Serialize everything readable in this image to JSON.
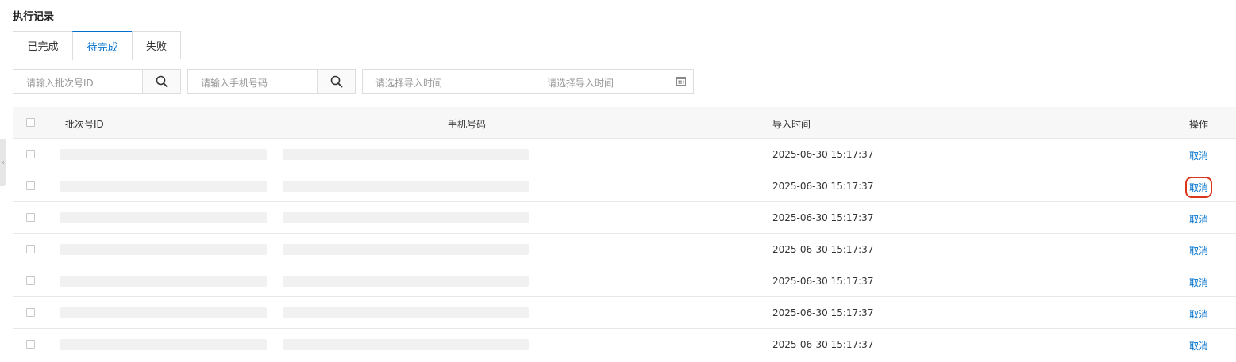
{
  "page": {
    "title": "执行记录"
  },
  "tabs": [
    {
      "label": "已完成",
      "active": false
    },
    {
      "label": "待完成",
      "active": true
    },
    {
      "label": "失败",
      "active": false
    }
  ],
  "filters": {
    "batch_placeholder": "请输入批次号ID",
    "phone_placeholder": "请输入手机号码",
    "date_start_placeholder": "请选择导入时间",
    "date_separator": "-",
    "date_end_placeholder": "请选择导入时间"
  },
  "table": {
    "headers": {
      "batch_id": "批次号ID",
      "phone": "手机号码",
      "import_time": "导入时间",
      "action": "操作"
    },
    "rows": [
      {
        "import_time": "2025-06-30 15:17:37",
        "action": "取消",
        "highlighted": false
      },
      {
        "import_time": "2025-06-30 15:17:37",
        "action": "取消",
        "highlighted": true
      },
      {
        "import_time": "2025-06-30 15:17:37",
        "action": "取消",
        "highlighted": false
      },
      {
        "import_time": "2025-06-30 15:17:37",
        "action": "取消",
        "highlighted": false
      },
      {
        "import_time": "2025-06-30 15:17:37",
        "action": "取消",
        "highlighted": false
      },
      {
        "import_time": "2025-06-30 15:17:37",
        "action": "取消",
        "highlighted": false
      },
      {
        "import_time": "2025-06-30 15:17:37",
        "action": "取消",
        "highlighted": false
      }
    ]
  },
  "colors": {
    "accent": "#0070cc",
    "highlight": "#d9361c"
  },
  "icons": {
    "search": "search-icon",
    "calendar": "calendar-icon",
    "collapse": "chevron-left-icon"
  }
}
